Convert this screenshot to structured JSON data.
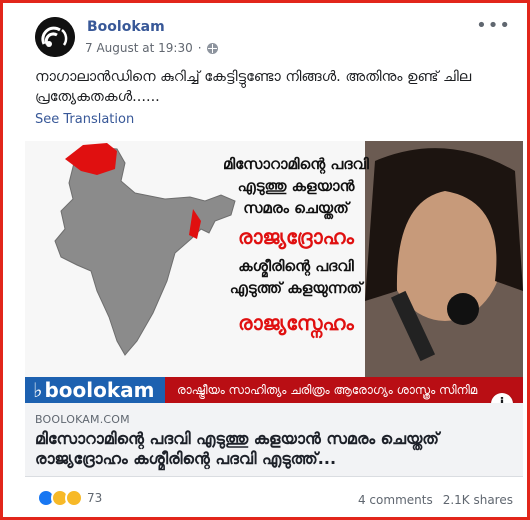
{
  "post": {
    "author": "Boolokam",
    "timestamp": "7 August at 19:30",
    "privacy_icon": "globe-icon",
    "more_icon": "more-options-icon",
    "text": "നാഗാലാൻഡിനെ കുറിച്ച് കേട്ടിട്ടുണ്ടോ നിങ്ങൾ. അതിനും ഉണ്ട് ചില പ്രത്യേകതകൾ......",
    "see_translation": "See Translation"
  },
  "image": {
    "slogan_line1": "മിസോറാമിന്റെ പദവി",
    "slogan_line2": "എടുത്തു കളയാൻ",
    "slogan_line3": "സമരം ചെയ്തത്",
    "slogan_line4": "രാജ്യദ്രോഹം",
    "slogan_line5": "കശ്മീരിന്റെ പദവി",
    "slogan_line6": "എടുത്ത് കളയുന്നത്",
    "slogan_line7": "രാജ്യസ്നേഹം",
    "brand": "boolokam",
    "categories": "രാഷ്ട്രീയം സാഹിത്യം ചരിത്രം ആരോഗ്യം ശാസ്ത്രം സിനിമ"
  },
  "link": {
    "domain": "BOOLOKAM.COM",
    "headline": "മിസോറാമിന്റെ പദവി എടുത്തു കളയാൻ സമരം ചെയ്തത് രാജ്യദ്രോഹം കശ്മീരിന്റെ പദവി എടുത്ത്..."
  },
  "footer": {
    "reaction_count": "73",
    "comments": "4 comments",
    "shares": "2.1K shares"
  },
  "colors": {
    "frame": "#e2261b",
    "link_blue": "#385898",
    "ribbon_red": "#b90e14",
    "brand_blue": "#1d61b0"
  }
}
